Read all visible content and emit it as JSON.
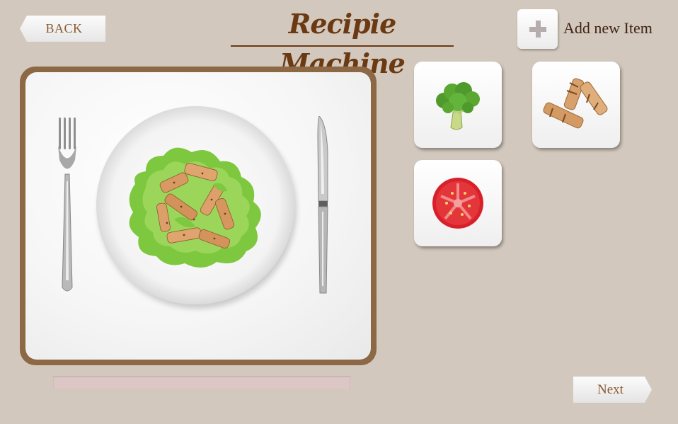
{
  "header": {
    "back_label": "BACK",
    "title": "Recipie Machine",
    "add_label": "Add new Item"
  },
  "placemat": {
    "food": "salad-with-grilled-chicken",
    "utensils": [
      "fork",
      "knife"
    ]
  },
  "progress": {
    "value": 0
  },
  "ingredients": [
    {
      "name": "broccoli",
      "icon": "broccoli-icon"
    },
    {
      "name": "grilled-chicken",
      "icon": "grilled-chicken-icon"
    },
    {
      "name": "tomato",
      "icon": "tomato-icon"
    }
  ],
  "footer": {
    "next_label": "Next"
  },
  "colors": {
    "background": "#d3c8bd",
    "title": "#6b3a12",
    "button_text": "#8a5a32",
    "placemat_border": "#8c6844",
    "progress_track": "#ddc6c6"
  }
}
